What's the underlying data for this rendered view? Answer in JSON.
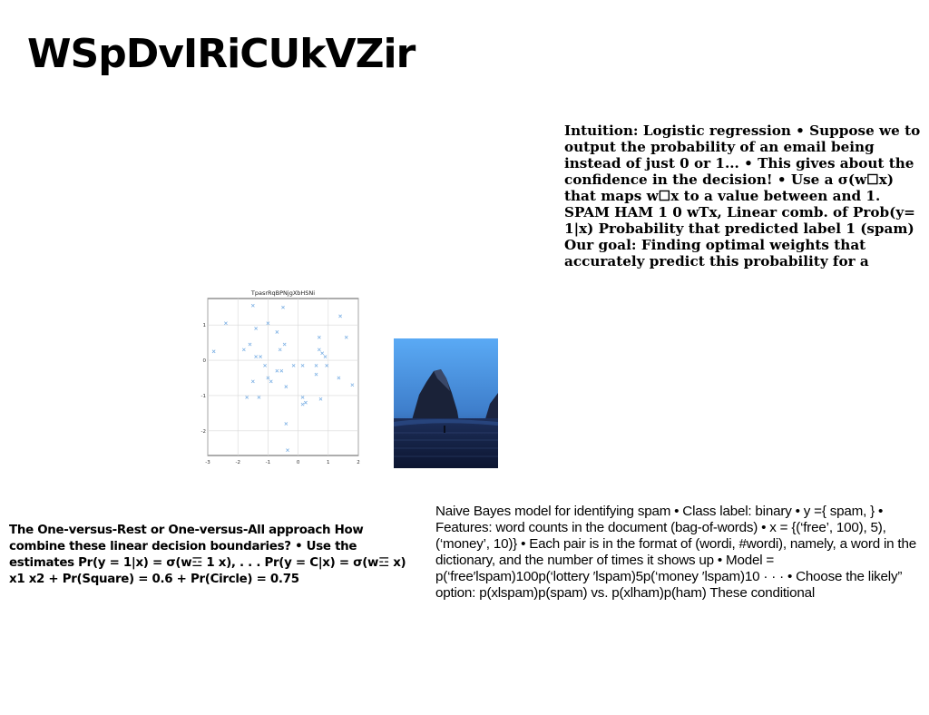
{
  "page": {
    "title": "WSpDvIRiCUkVZir"
  },
  "blocks": {
    "top_right": "Intuition: Logistic regression • Suppose we to output the probability of an email being instead of just 0 or 1... • This gives about the confidence in the decision! • Use a σ(w☐x) that maps w☐x to a value between and 1. SPAM HAM 1 0 wTx, Linear comb. of Prob(y= 1|x) Probability that predicted label 1 (spam) Our goal: Finding optimal weights that accurately predict this probability for a",
    "bottom_left": "The One-versus-Rest or One-versus-All approach How combine these linear decision boundaries? • Use the estimates Pr(y = 1|x) = σ(w☲ 1 x), . . . Pr(y = C|x) = σ(w☲ x) x1 x2 + Pr(Square) = 0.6 + Pr(Circle) = 0.75",
    "bottom_right": "Naive Bayes model for identifying spam • Class label: binary • y ={ spam, } • Features: word counts in the document (bag-of-words) • x = {(‘free’, 100), 5), (‘money’, 10)} • Each pair is in the format of (wordi, #wordi), namely, a word in the dictionary, and the number of times it shows up • Model = p(‘free′lspam)100p(‘lottery ′lspam)5p(‘money ′lspam)10 · · · • Choose the likely” option: p(xlspam)p(spam) vs. p(xlham)p(ham) These conditional"
  },
  "chart_data": {
    "type": "scatter",
    "title": "TpasrRqBPNjgXbHSNi",
    "xlabel": "",
    "ylabel": "",
    "xlim": [
      -3,
      2
    ],
    "ylim": [
      -2.7,
      1.75
    ],
    "xticks": [
      "-3",
      "-2",
      "-1",
      "0",
      "1",
      "2"
    ],
    "yticks": [
      "1",
      "0",
      "-1",
      "-2"
    ],
    "grid": true,
    "marker": "x",
    "color": "#7fb2e5",
    "points": [
      [
        -1.5,
        1.55
      ],
      [
        -0.5,
        1.5
      ],
      [
        1.4,
        1.25
      ],
      [
        -1.0,
        1.05
      ],
      [
        -2.4,
        1.05
      ],
      [
        -1.4,
        0.9
      ],
      [
        -0.7,
        0.8
      ],
      [
        1.6,
        0.65
      ],
      [
        0.7,
        0.65
      ],
      [
        -1.6,
        0.45
      ],
      [
        -0.45,
        0.45
      ],
      [
        -2.8,
        0.25
      ],
      [
        -1.8,
        0.3
      ],
      [
        -0.6,
        0.3
      ],
      [
        0.7,
        0.3
      ],
      [
        0.8,
        0.2
      ],
      [
        -1.4,
        0.1
      ],
      [
        -1.25,
        0.1
      ],
      [
        0.9,
        0.1
      ],
      [
        -1.1,
        -0.15
      ],
      [
        0.15,
        -0.15
      ],
      [
        -0.15,
        -0.15
      ],
      [
        0.6,
        -0.15
      ],
      [
        0.95,
        -0.15
      ],
      [
        -0.7,
        -0.3
      ],
      [
        -0.55,
        -0.3
      ],
      [
        -1.0,
        -0.5
      ],
      [
        -0.9,
        -0.6
      ],
      [
        0.6,
        -0.4
      ],
      [
        1.35,
        -0.5
      ],
      [
        -1.5,
        -0.6
      ],
      [
        -0.4,
        -0.75
      ],
      [
        1.8,
        -0.7
      ],
      [
        -1.7,
        -1.05
      ],
      [
        -1.3,
        -1.05
      ],
      [
        0.15,
        -1.05
      ],
      [
        0.75,
        -1.1
      ],
      [
        0.25,
        -1.2
      ],
      [
        0.15,
        -1.25
      ],
      [
        -0.4,
        -1.8
      ],
      [
        -0.35,
        -2.55
      ]
    ]
  }
}
